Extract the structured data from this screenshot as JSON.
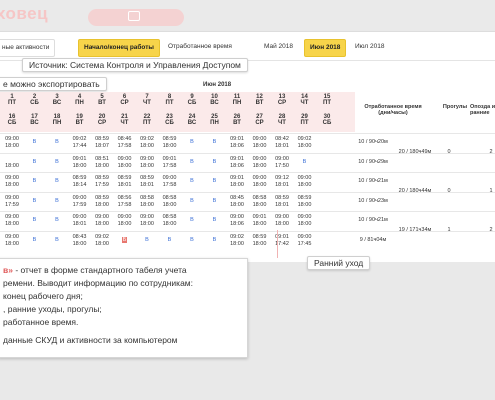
{
  "header": {
    "title": "ховец",
    "button_label": ""
  },
  "tabs": {
    "items": [
      {
        "label": "ные активности",
        "active": false
      },
      {
        "label": "Начало/конец работы",
        "active": true
      },
      {
        "label": "Отработанное время",
        "active": false
      },
      {
        "label": "Май 2018",
        "active": false
      },
      {
        "label": "Июн 2018",
        "active": true
      },
      {
        "label": "Июл 2018",
        "active": false
      }
    ]
  },
  "callouts": {
    "source": "Источник: Система Контроля и Управления Доступом",
    "export": "е можно экспортировать",
    "late": "Ранний уход"
  },
  "table": {
    "month": "Июн 2018",
    "days_top": [
      {
        "n": "1",
        "d": "ПТ"
      },
      {
        "n": "2",
        "d": "СБ"
      },
      {
        "n": "3",
        "d": "ВС"
      },
      {
        "n": "4",
        "d": "ПН"
      },
      {
        "n": "5",
        "d": "ВТ"
      },
      {
        "n": "6",
        "d": "СР"
      },
      {
        "n": "7",
        "d": "ЧТ"
      },
      {
        "n": "8",
        "d": "ПТ"
      },
      {
        "n": "9",
        "d": "СБ"
      },
      {
        "n": "10",
        "d": "ВС"
      },
      {
        "n": "11",
        "d": "ПН"
      },
      {
        "n": "12",
        "d": "ВТ"
      },
      {
        "n": "13",
        "d": "СР"
      },
      {
        "n": "14",
        "d": "ЧТ"
      },
      {
        "n": "15",
        "d": "ПТ"
      }
    ],
    "days_bottom": [
      {
        "n": "16",
        "d": "СБ"
      },
      {
        "n": "17",
        "d": "ВС"
      },
      {
        "n": "18",
        "d": "ПН"
      },
      {
        "n": "19",
        "d": "ВТ"
      },
      {
        "n": "20",
        "d": "СР"
      },
      {
        "n": "21",
        "d": "ЧТ"
      },
      {
        "n": "22",
        "d": "ПТ"
      },
      {
        "n": "23",
        "d": "СБ"
      },
      {
        "n": "24",
        "d": "ВС"
      },
      {
        "n": "25",
        "d": "ПН"
      },
      {
        "n": "26",
        "d": "ВТ"
      },
      {
        "n": "27",
        "d": "СР"
      },
      {
        "n": "28",
        "d": "ЧТ"
      },
      {
        "n": "29",
        "d": "ПТ"
      },
      {
        "n": "30",
        "d": "СБ"
      }
    ],
    "close_label": "×",
    "col_worked": "Отработанное время (дни/часы)",
    "col_absence": "Прогулы",
    "col_late": "Опозда и ранние",
    "rows": [
      {
        "a": "09:00",
        "b": "18:00",
        "cells": [
          [
            "В",
            ""
          ],
          [
            "В",
            ""
          ],
          [
            "09:02",
            "17:44"
          ],
          [
            "08:59",
            "18:07"
          ],
          [
            "08:46",
            "17:58"
          ],
          [
            "09:02",
            "18:00"
          ],
          [
            "08:59",
            "18:00"
          ],
          [
            "В",
            ""
          ],
          [
            "В",
            ""
          ],
          [
            "09:01",
            "18:06"
          ],
          [
            "09:00",
            "18:00"
          ],
          [
            "08:42",
            "18:01"
          ],
          [
            "09:02",
            "18:00"
          ]
        ],
        "worked": "10 / 90ч20м",
        "worked2": "20 / 180ч49м",
        "abs": "0",
        "late": "2"
      },
      {
        "a": "",
        "b": "18:00",
        "cells": [
          [
            "В",
            ""
          ],
          [
            "В",
            ""
          ],
          [
            "09:01",
            "18:00"
          ],
          [
            "08:51",
            "18:00"
          ],
          [
            "09:00",
            "18:00"
          ],
          [
            "09:00",
            "18:00"
          ],
          [
            "09:01",
            "17:58"
          ],
          [
            "В",
            ""
          ],
          [
            "В",
            ""
          ],
          [
            "09:01",
            "18:06"
          ],
          [
            "09:00",
            "18:00"
          ],
          [
            "09:00",
            "17:50"
          ],
          [
            "В",
            ""
          ]
        ],
        "worked": "10 / 90ч29м",
        "worked2": "",
        "abs": "",
        "late": ""
      },
      {
        "a": "09:00",
        "b": "18:00",
        "cells": [
          [
            "В",
            ""
          ],
          [
            "В",
            ""
          ],
          [
            "08:59",
            "18:14"
          ],
          [
            "08:59",
            "17:59"
          ],
          [
            "08:59",
            "18:01"
          ],
          [
            "08:59",
            "18:01"
          ],
          [
            "09:00",
            "17:58"
          ],
          [
            "В",
            ""
          ],
          [
            "В",
            ""
          ],
          [
            "09:01",
            "18:00"
          ],
          [
            "09:00",
            "18:00"
          ],
          [
            "09:12",
            "18:01"
          ],
          [
            "09:00",
            "18:00"
          ]
        ],
        "worked": "10 / 90ч21м",
        "worked2": "20 / 180ч44м",
        "abs": "0",
        "late": "1"
      },
      {
        "a": "09:00",
        "b": "17:59",
        "cells": [
          [
            "В",
            ""
          ],
          [
            "В",
            ""
          ],
          [
            "09:00",
            "17:59"
          ],
          [
            "08:59",
            "18:00"
          ],
          [
            "08:56",
            "17:58"
          ],
          [
            "08:58",
            "18:00"
          ],
          [
            "08:58",
            "18:00"
          ],
          [
            "В",
            ""
          ],
          [
            "В",
            ""
          ],
          [
            "08:45",
            "18:00"
          ],
          [
            "08:58",
            "18:00"
          ],
          [
            "08:59",
            "18:01"
          ],
          [
            "08:59",
            "18:00"
          ]
        ],
        "worked": "10 / 90ч23м",
        "worked2": "",
        "abs": "",
        "late": ""
      },
      {
        "a": "09:00",
        "b": "18:00",
        "cells": [
          [
            "В",
            ""
          ],
          [
            "В",
            ""
          ],
          [
            "09:00",
            "18:01"
          ],
          [
            "09:00",
            "18:00"
          ],
          [
            "09:00",
            "18:00"
          ],
          [
            "09:00",
            "18:00"
          ],
          [
            "08:58",
            "18:00"
          ],
          [
            "В",
            ""
          ],
          [
            "В",
            ""
          ],
          [
            "09:00",
            "18:06"
          ],
          [
            "09:01",
            "18:00"
          ],
          [
            "09:00",
            "18:00"
          ],
          [
            "09:00",
            "18:00"
          ]
        ],
        "worked": "10 / 90ч21м",
        "worked2": "19 / 171ч34м",
        "abs": "1",
        "late": "2"
      },
      {
        "a": "09:00",
        "b": "18:00",
        "cells": [
          [
            "В",
            ""
          ],
          [
            "В",
            ""
          ],
          [
            "08:43",
            "18:00"
          ],
          [
            "09:02",
            "18:00"
          ],
          [
            "Б",
            ""
          ],
          [
            "В",
            ""
          ],
          [
            "В",
            ""
          ],
          [
            "В",
            ""
          ],
          [
            "В",
            ""
          ],
          [
            "09:02",
            "18:00"
          ],
          [
            "08:59",
            "18:00"
          ],
          [
            "09:01",
            "17:42"
          ],
          [
            "09:00",
            "17:45"
          ]
        ],
        "worked": "9 / 81ч04м",
        "worked2": "",
        "abs": "",
        "late": ""
      }
    ]
  },
  "info": {
    "line1_hl": "в»",
    "line1": " - отчет в форме стандартного табеля учета",
    "line2": "ремени. Выводит информацию по сотрудникам:",
    "line3": "конец рабочего дня;",
    "line4": ", ранние уходы, прогулы;",
    "line5": "работанное время.",
    "line6": "данные СКУД и активности за компьютером"
  }
}
